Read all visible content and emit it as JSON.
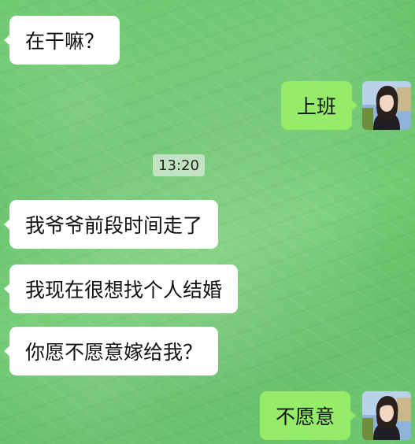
{
  "chat": {
    "timestamp": "13:20",
    "messages": [
      {
        "side": "incoming",
        "text": "在干嘛？"
      },
      {
        "side": "outgoing",
        "text": "上班"
      },
      {
        "side": "incoming",
        "text": "我爷爷前段时间走了"
      },
      {
        "side": "incoming",
        "text": "我现在很想找个人结婚"
      },
      {
        "side": "incoming",
        "text": "你愿不愿意嫁给我？"
      },
      {
        "side": "outgoing",
        "text": "不愿意"
      }
    ]
  },
  "colors": {
    "background": "#5fc262",
    "incoming_bubble": "#ffffff",
    "outgoing_bubble": "#95ec69",
    "text": "#111111"
  },
  "icons": {
    "avatar": "user-avatar-photo"
  }
}
